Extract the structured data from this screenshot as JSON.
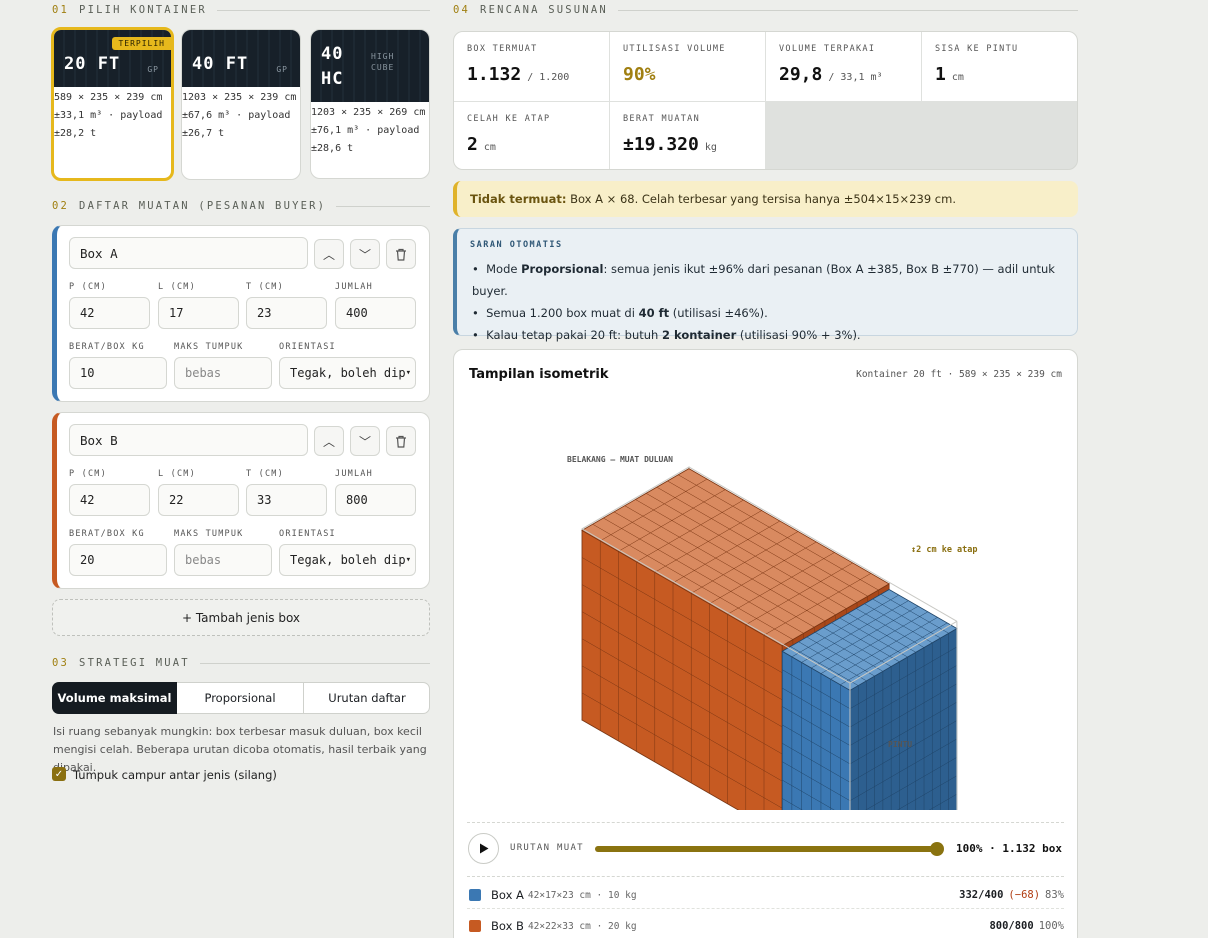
{
  "sections": {
    "s1": {
      "num": "01",
      "title": "PILIH KONTAINER"
    },
    "s2": {
      "num": "02",
      "title": "DAFTAR MUATAN (PESANAN BUYER)"
    },
    "s3": {
      "num": "03",
      "title": "STRATEGI MUAT"
    },
    "s4": {
      "num": "04",
      "title": "RENCANA SUSUNAN"
    }
  },
  "containers": [
    {
      "name": "20 FT",
      "sub": "GP",
      "badge": "TERPILIH",
      "info": "589 × 235 × 239 cm ±33,1 m³ · payload ±28,2 t"
    },
    {
      "name": "40 FT",
      "sub": "GP",
      "info": "1203 × 235 × 239 cm ±67,6 m³ · payload ±26,7 t"
    },
    {
      "name": "40 HC",
      "sub": "HIGH CUBE",
      "info": "1203 × 235 × 269 cm ±76,1 m³ · payload ±28,6 t"
    }
  ],
  "labels": {
    "p": "P (CM)",
    "l": "L (CM)",
    "t": "T (CM)",
    "jumlah": "JUMLAH",
    "berat": "BERAT/BOX KG",
    "maks": "MAKS TUMPUK",
    "orientasi": "ORIENTASI"
  },
  "boxes": [
    {
      "name": "Box A",
      "p": "42",
      "l": "17",
      "t": "23",
      "jumlah": "400",
      "berat": "10",
      "maks_placeholder": "bebas",
      "orientasi": "Tegak, boleh dipu",
      "color": "#3b78b3"
    },
    {
      "name": "Box B",
      "p": "42",
      "l": "22",
      "t": "33",
      "jumlah": "800",
      "berat": "20",
      "maks_placeholder": "bebas",
      "orientasi": "Tegak, boleh dipu",
      "color": "#c65a22"
    }
  ],
  "add_box": "+ Tambah jenis box",
  "strategy": {
    "options": [
      "Volume maksimal",
      "Proporsional",
      "Urutan daftar"
    ],
    "selected": "Volume maksimal",
    "description": "Isi ruang sebanyak mungkin: box terbesar masuk duluan, box kecil mengisi celah. Beberapa urutan dicoba otomatis, hasil terbaik yang dipakai.",
    "checkbox_label": "Tumpuk campur antar jenis (silang)",
    "checkbox_checked": true
  },
  "stats": [
    {
      "label": "BOX TERMUAT",
      "value": "1.132",
      "unit": "/ 1.200"
    },
    {
      "label": "UTILISASI VOLUME",
      "value": "90%",
      "unit": "",
      "color": "#a07f10"
    },
    {
      "label": "VOLUME TERPAKAI",
      "value": "29,8",
      "unit": "/ 33,1 m³"
    },
    {
      "label": "SISA KE PINTU",
      "value": "1",
      "unit": "cm"
    },
    {
      "label": "CELAH KE ATAP",
      "value": "2",
      "unit": "cm"
    },
    {
      "label": "BERAT MUATAN",
      "value": "±19.320",
      "unit": "kg"
    }
  ],
  "warning": {
    "bold": "Tidak termuat:",
    "text": "Box A × 68. Celah terbesar yang tersisa hanya ±504×15×239 cm."
  },
  "suggest": {
    "title": "SARAN OTOMATIS",
    "items": [
      {
        "a": "Mode ",
        "b": "Proporsional",
        "c": ": semua jenis ikut ±96% dari pesanan (Box A ±385, Box B ±770) — adil untuk buyer."
      },
      {
        "a": "Semua 1.200 box muat di ",
        "b": "40 ft",
        "c": " (utilisasi ±46%)."
      },
      {
        "a": "Kalau tetap pakai 20 ft: butuh ",
        "b": "2 kontainer",
        "c": " (utilisasi 90% + 3%)."
      }
    ]
  },
  "iso": {
    "title": "Tampilan isometrik",
    "meta": "Kontainer 20 ft · 589 × 235 × 239 cm",
    "label_back": "BELAKANG — MUAT DULUAN",
    "label_gap": "↕2 cm ke atap",
    "label_door": "PINTU",
    "order_label": "URUTAN MUAT",
    "progress": 1.0,
    "progress_text": "100% · 1.132 box"
  },
  "legend": [
    {
      "name": "Box A",
      "dims": "42×17×23 cm · 10 kg",
      "count": "332/400",
      "diff": "(−68)",
      "pct": "83%",
      "color": "#3b78b3"
    },
    {
      "name": "Box B",
      "dims": "42×22×33 cm · 20 kg",
      "count": "800/800",
      "diff": "",
      "pct": "100%",
      "color": "#c65a22"
    }
  ]
}
